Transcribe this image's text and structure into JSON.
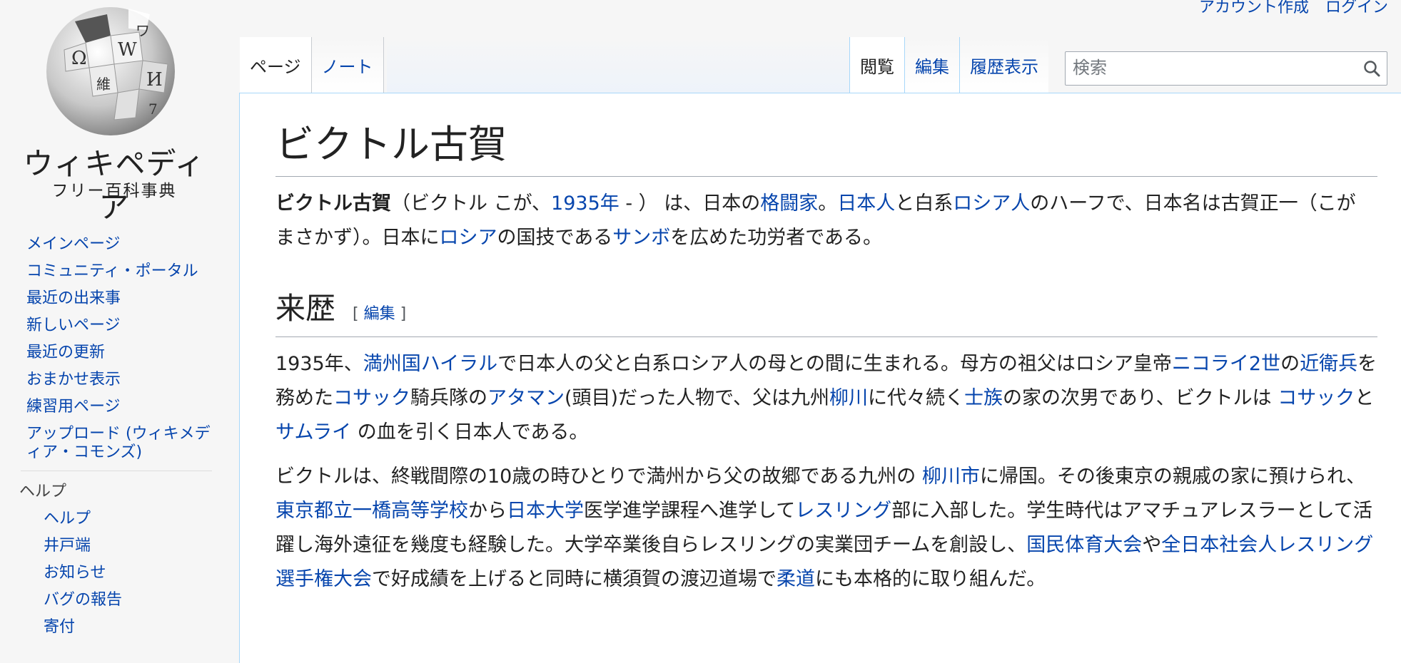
{
  "personal": {
    "create_account": "アカウント作成",
    "login": "ログイン"
  },
  "logo": {
    "wordmark": "ウィキペディア",
    "tagline": "フリー百科事典"
  },
  "sidebar": {
    "nav": [
      "メインページ",
      "コミュニティ・ポータル",
      "最近の出来事",
      "新しいページ",
      "最近の更新",
      "おまかせ表示",
      "練習用ページ",
      "アップロード (ウィキメディア・コモンズ)"
    ],
    "help_heading": "ヘルプ",
    "help": [
      "ヘルプ",
      "井戸端",
      "お知らせ",
      "バグの報告",
      "寄付"
    ]
  },
  "tabs": {
    "page": "ページ",
    "talk": "ノート",
    "read": "閲覧",
    "edit": "編集",
    "history": "履歴表示"
  },
  "search": {
    "placeholder": "検索"
  },
  "article": {
    "title": "ビクトル古賀",
    "lead": {
      "bold": "ビクトル古賀",
      "a1": "（ビクトル こが、",
      "l1": "1935年",
      "a2": " - ） は、日本の",
      "l2": "格闘家",
      "a3": "。",
      "l3": "日本人",
      "a4": "と白系",
      "l4": "ロシア人",
      "a5": "のハーフで、日本名は古賀正一（こが まさかず）。日本に",
      "l5": "ロシア",
      "a6": "の国技である",
      "l6": "サンボ",
      "a7": "を広めた功労者である。"
    },
    "section_title": "来歴",
    "section_edit": "編集",
    "p1": {
      "a1": "1935年、",
      "l1": "満州国ハイラル",
      "a2": "で日本人の父と白系ロシア人の母との間に生まれる。母方の祖父はロシア皇帝",
      "l2": "ニコライ2世",
      "a3": "の",
      "l3": "近衛兵",
      "a4": "を務めた",
      "l4": "コサック",
      "a5": "騎兵隊の",
      "l5": "アタマン",
      "a6": "(頭目)だった人物で、父は九州",
      "l6": "柳川",
      "a7": "に代々続く",
      "l7": "士族",
      "a8": "の家の次男であり、ビクトルは ",
      "l8": "コサック",
      "a9": "と",
      "l9": "サムライ",
      "a10": " の血を引く日本人である。"
    },
    "p2": {
      "a1": "ビクトルは、終戦間際の10歳の時ひとりで満州から父の故郷である九州の ",
      "l1": "柳川市",
      "a2": "に帰国。その後東京の親戚の家に預けられ、",
      "l2": "東京都立一橋高等学校",
      "a3": "から",
      "l3": "日本大学",
      "a4": "医学進学課程へ進学して",
      "l4": "レスリング",
      "a5": "部に入部した。学生時代はアマチュアレスラーとして活躍し海外遠征を幾度も経験した。大学卒業後自らレスリングの実業団チームを創設し、",
      "l5": "国民体育大会",
      "a6": "や",
      "l6": "全日本社会人レスリング選手権大会",
      "a7": "で好成績を上げると同時に横須賀の渡辺道場で",
      "l7": "柔道",
      "a8": "にも本格的に取り組んだ。"
    }
  }
}
